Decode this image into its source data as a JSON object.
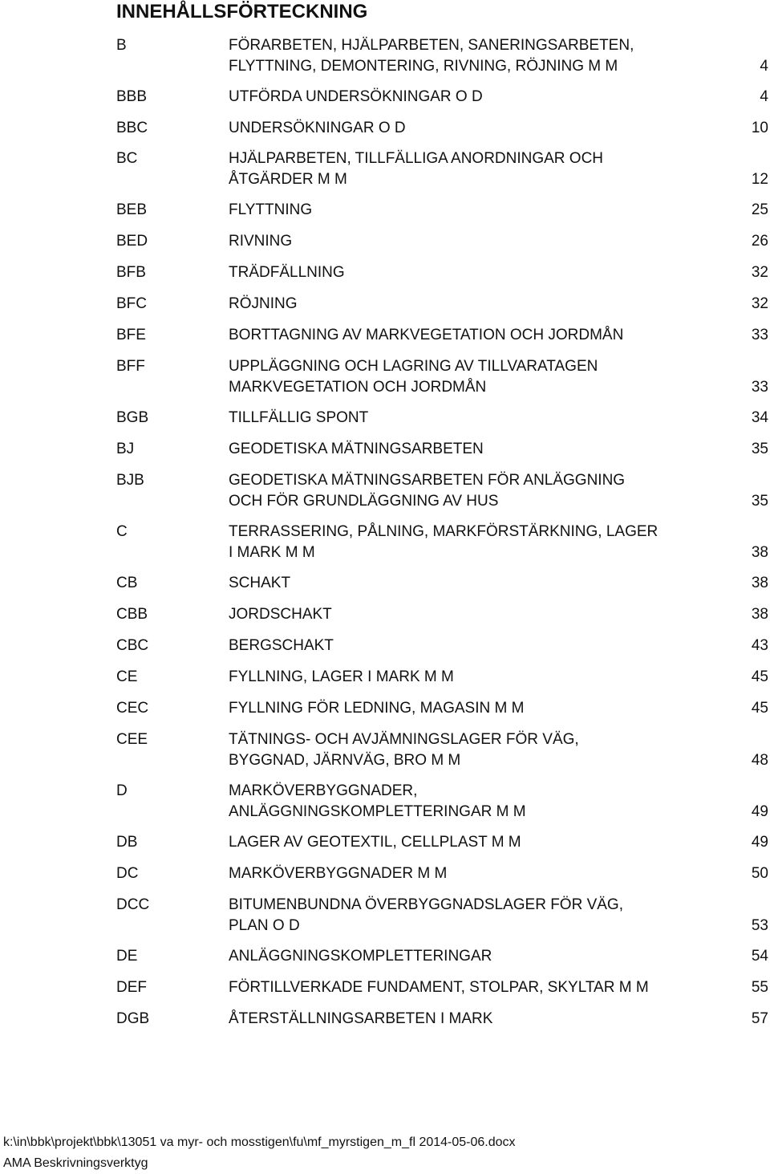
{
  "title": "INNEHÅLLSFÖRTECKNING",
  "entries": [
    {
      "code": "B",
      "text": "FÖRARBETEN, HJÄLPARBETEN, SANERINGSARBETEN,\nFLYTTNING, DEMONTERING, RIVNING, RÖJNING M M",
      "page": "4"
    },
    {
      "code": "BBB",
      "text": "UTFÖRDA UNDERSÖKNINGAR O D",
      "page": "4"
    },
    {
      "code": "BBC",
      "text": "UNDERSÖKNINGAR O D",
      "page": "10"
    },
    {
      "code": "BC",
      "text": "HJÄLPARBETEN, TILLFÄLLIGA ANORDNINGAR OCH\nÅTGÄRDER M M",
      "page": "12"
    },
    {
      "code": "BEB",
      "text": "FLYTTNING",
      "page": "25"
    },
    {
      "code": "BED",
      "text": "RIVNING",
      "page": "26"
    },
    {
      "code": "BFB",
      "text": "TRÄDFÄLLNING",
      "page": "32"
    },
    {
      "code": "BFC",
      "text": "RÖJNING",
      "page": "32"
    },
    {
      "code": "BFE",
      "text": "BORTTAGNING AV MARKVEGETATION OCH JORDMÅN",
      "page": "33"
    },
    {
      "code": "BFF",
      "text": "UPPLÄGGNING OCH LAGRING AV TILLVARATAGEN\nMARKVEGETATION OCH JORDMÅN",
      "page": "33"
    },
    {
      "code": "BGB",
      "text": "TILLFÄLLIG SPONT",
      "page": "34"
    },
    {
      "code": "BJ",
      "text": "GEODETISKA MÄTNINGSARBETEN",
      "page": "35"
    },
    {
      "code": "BJB",
      "text": "GEODETISKA MÄTNINGSARBETEN FÖR ANLÄGGNING\nOCH FÖR GRUNDLÄGGNING AV HUS",
      "page": "35"
    },
    {
      "code": "C",
      "text": "TERRASSERING, PÅLNING, MARKFÖRSTÄRKNING, LAGER\nI MARK M M",
      "page": "38"
    },
    {
      "code": "CB",
      "text": "SCHAKT",
      "page": "38"
    },
    {
      "code": "CBB",
      "text": "JORDSCHAKT",
      "page": "38"
    },
    {
      "code": "CBC",
      "text": "BERGSCHAKT",
      "page": "43"
    },
    {
      "code": "CE",
      "text": "FYLLNING, LAGER I MARK M M",
      "page": "45"
    },
    {
      "code": "CEC",
      "text": "FYLLNING FÖR LEDNING, MAGASIN M M",
      "page": "45"
    },
    {
      "code": "CEE",
      "text": "TÄTNINGS- OCH AVJÄMNINGSLAGER FÖR VÄG,\nBYGGNAD, JÄRNVÄG, BRO M M",
      "page": "48"
    },
    {
      "code": "D",
      "text": "MARKÖVERBYGGNADER,\nANLÄGGNINGSKOMPLETTERINGAR M M",
      "page": "49"
    },
    {
      "code": "DB",
      "text": "LAGER AV GEOTEXTIL, CELLPLAST M M",
      "page": "49"
    },
    {
      "code": "DC",
      "text": "MARKÖVERBYGGNADER M M",
      "page": "50"
    },
    {
      "code": "DCC",
      "text": "BITUMENBUNDNA ÖVERBYGGNADSLAGER FÖR VÄG,\nPLAN O D",
      "page": "53"
    },
    {
      "code": "DE",
      "text": "ANLÄGGNINGSKOMPLETTERINGAR",
      "page": "54"
    },
    {
      "code": "DEF",
      "text": "FÖRTILLVERKADE FUNDAMENT, STOLPAR, SKYLTAR M M",
      "page": "55"
    },
    {
      "code": "DGB",
      "text": "ÅTERSTÄLLNINGSARBETEN I MARK",
      "page": "57"
    }
  ],
  "footer": {
    "path": "k:\\in\\bbk\\projekt\\bbk\\13051 va myr- och mosstigen\\fu\\mf_myrstigen_m_fl 2014-05-06.docx",
    "tool": "AMA Beskrivningsverktyg"
  }
}
